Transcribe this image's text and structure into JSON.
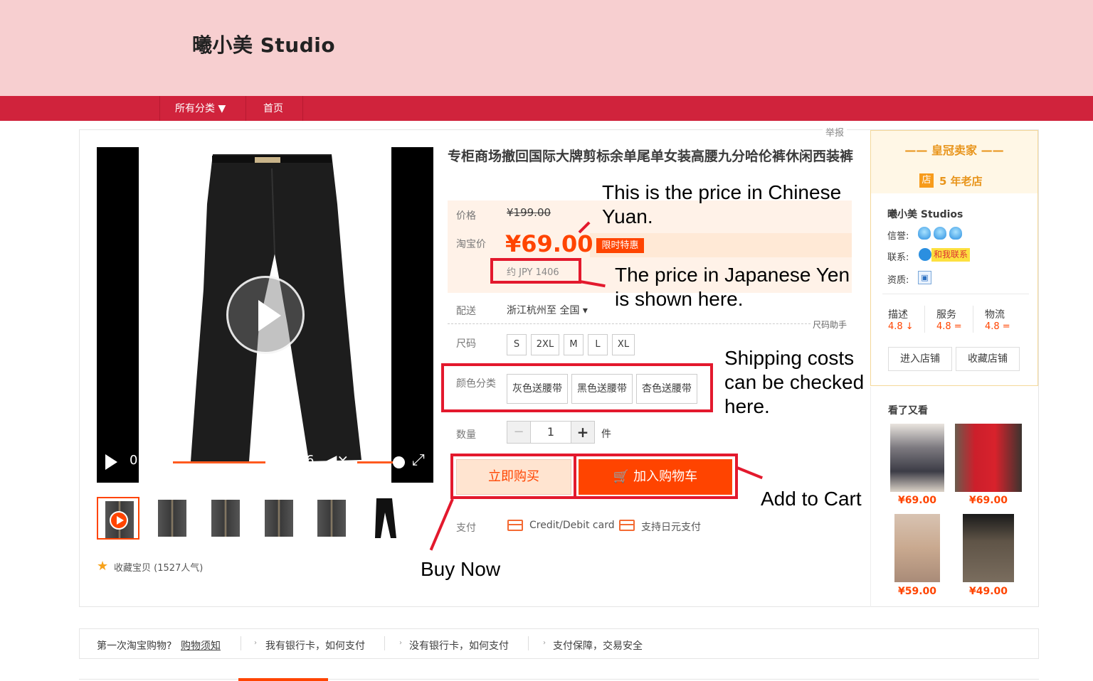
{
  "header": {
    "store_name": "曦小美 Studio"
  },
  "nav": {
    "all_categories": "所有分类 ▼",
    "home": "首页"
  },
  "report": "举报",
  "product": {
    "title": "专柜商场撤回国际大牌剪标余单尾单女装高腰九分哈伦裤休闲西装裤",
    "price_label": "价格",
    "original_price": "¥199.00",
    "taobao_price_label": "淘宝价",
    "price": "¥69.00",
    "promo": "限时特惠",
    "jpy_price": "约 JPY 1406",
    "shipping_label": "配送",
    "shipping_value": "浙江杭州至  全国 ▾",
    "size_helper": "尺码助手",
    "size_label": "尺码",
    "sizes": [
      "S",
      "2XL",
      "M",
      "L",
      "XL"
    ],
    "color_label": "颜色分类",
    "colors": [
      "灰色送腰带",
      "黑色送腰带",
      "杏色送腰带"
    ],
    "qty_label": "数量",
    "qty_minus": "−",
    "qty_value": "1",
    "qty_plus": "+",
    "qty_unit": "件",
    "buy_now": "立即购买",
    "add_to_cart": "加入购物车",
    "cart_icon": "🛒",
    "payment_label": "支付",
    "payment_methods": [
      "Credit/Debit card",
      "支持日元支付"
    ]
  },
  "gallery": {
    "time_start": "0",
    "time_end": "6",
    "favorite": "收藏宝贝 (1527人气)",
    "icons": [
      "play-icon",
      "mute-icon",
      "fullscreen-icon",
      "star-icon"
    ]
  },
  "annotations": {
    "cny": "This is the price in Chinese Yuan.",
    "jpy": "The price in Japanese Yen is shown here.",
    "shipping": "Shipping costs can be checked here.",
    "cart": "Add to Cart",
    "buy": "Buy Now",
    "color": "#e3192d"
  },
  "seller": {
    "badge": "—— 皇冠卖家 ——",
    "shop_age_icon": "店",
    "shop_age": "5 年老店",
    "name": "曦小美 Studios",
    "credit_label": "信誉:",
    "contact_label": "联系:",
    "contact_badge": "和我联系",
    "qual_label": "资质:",
    "ratings": [
      {
        "label": "描述",
        "value": "4.8 ↓"
      },
      {
        "label": "服务",
        "value": "4.8 ="
      },
      {
        "label": "物流",
        "value": "4.8 ="
      }
    ],
    "enter_shop": "进入店铺",
    "favorite_shop": "收藏店铺"
  },
  "also_viewed": {
    "title": "看了又看",
    "prices": [
      "¥69.00",
      "¥69.00",
      "¥59.00",
      "¥49.00"
    ]
  },
  "footer": {
    "first_time": "第一次淘宝购物?",
    "shopping_guide": "购物须知",
    "links": [
      "我有银行卡，如何支付",
      "没有银行卡，如何支付",
      "支付保障，交易安全"
    ]
  }
}
